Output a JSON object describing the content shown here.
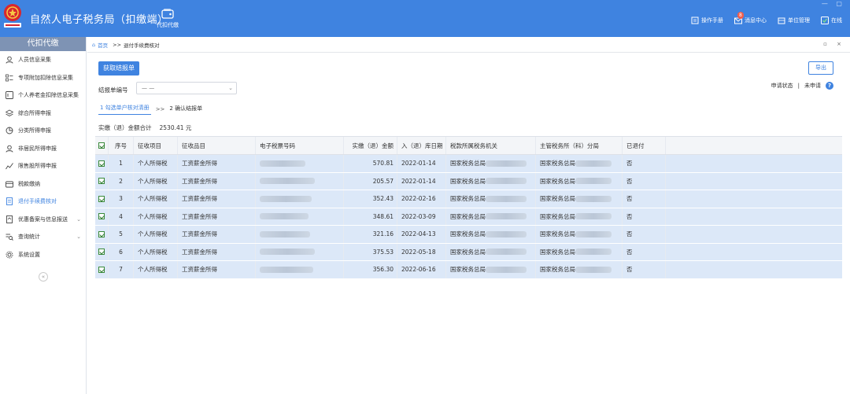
{
  "app": {
    "title": "自然人电子税务局（扣缴端）",
    "nav_label": "代扣代缴",
    "window_controls": "— ▢"
  },
  "top_actions": [
    {
      "label": "操作手册",
      "icon": "book-icon"
    },
    {
      "label": "消息中心",
      "icon": "mail-icon",
      "badge": "8"
    },
    {
      "label": "单位管理",
      "icon": "building-icon"
    },
    {
      "label": "在线",
      "icon": "online-check-icon"
    }
  ],
  "sidebar": {
    "header": "代扣代缴",
    "items": [
      {
        "label": "人员信息采集",
        "icon": "person-icon"
      },
      {
        "label": "专项附加扣除信息采集",
        "icon": "list-icon"
      },
      {
        "label": "个人养老金扣除信息采集",
        "icon": "card-icon"
      },
      {
        "label": "综合所得申报",
        "icon": "layers-icon"
      },
      {
        "label": "分类所得申报",
        "icon": "pie-icon"
      },
      {
        "label": "非居民所得申报",
        "icon": "user-globe-icon"
      },
      {
        "label": "限售股所得申报",
        "icon": "chart-icon"
      },
      {
        "label": "税款缴纳",
        "icon": "wallet-icon"
      },
      {
        "label": "退付手续费核对",
        "icon": "doc-icon",
        "active": true
      },
      {
        "label": "优惠备案与信息报送",
        "icon": "file-up-icon",
        "chevron": "⌄"
      },
      {
        "label": "查询统计",
        "icon": "search-list-icon",
        "chevron": "⌄"
      },
      {
        "label": "系统设置",
        "icon": "gear-icon"
      }
    ],
    "collapse": "«"
  },
  "breadcrumb": {
    "home": "首页",
    "sep": ">>",
    "current": "退付手续费核对",
    "controls": "▫ ×"
  },
  "toolbar": {
    "fetch_label": "获取结报单",
    "export_label": "导出",
    "status_label": "申请状态",
    "status_divider": "|",
    "status_value": "未申请",
    "help": "?"
  },
  "form": {
    "label": "结报单编号",
    "select_value": "— —",
    "caret": "⌄"
  },
  "steps": {
    "step1": "1 勾选单户核对清册",
    "sep": ">>",
    "step2": "2 确认结报单"
  },
  "total": {
    "label": "实缴（退）金额合计",
    "value": "2530.41 元"
  },
  "table": {
    "headers": [
      "序号",
      "征收项目",
      "征收品目",
      "电子税票号码",
      "实缴（退）金额",
      "入（退）库日期",
      "税款所属税务机关",
      "主管税务所（科）分局",
      "已退付"
    ],
    "rows": [
      {
        "no": "1",
        "item": "个人所得税",
        "category": "工资薪金所得",
        "amount": "570.81",
        "date": "2022-01-14",
        "org": "国家税务总局",
        "tax": "国家税务总局",
        "returned": "否"
      },
      {
        "no": "2",
        "item": "个人所得税",
        "category": "工资薪金所得",
        "amount": "205.57",
        "date": "2022-01-14",
        "org": "国家税务总局",
        "tax": "国家税务总局",
        "returned": "否"
      },
      {
        "no": "3",
        "item": "个人所得税",
        "category": "工资薪金所得",
        "amount": "352.43",
        "date": "2022-02-16",
        "org": "国家税务总局",
        "tax": "国家税务总局",
        "returned": "否"
      },
      {
        "no": "4",
        "item": "个人所得税",
        "category": "工资薪金所得",
        "amount": "348.61",
        "date": "2022-03-09",
        "org": "国家税务总局",
        "tax": "国家税务总局",
        "returned": "否"
      },
      {
        "no": "5",
        "item": "个人所得税",
        "category": "工资薪金所得",
        "amount": "321.16",
        "date": "2022-04-13",
        "org": "国家税务总局",
        "tax": "国家税务总局",
        "returned": "否"
      },
      {
        "no": "6",
        "item": "个人所得税",
        "category": "工资薪金所得",
        "amount": "375.53",
        "date": "2022-05-18",
        "org": "国家税务总局",
        "tax": "国家税务总局",
        "returned": "否"
      },
      {
        "no": "7",
        "item": "个人所得税",
        "category": "工资薪金所得",
        "amount": "356.30",
        "date": "2022-06-16",
        "org": "国家税务总局",
        "tax": "国家税务总局",
        "returned": "否"
      }
    ]
  },
  "colors": {
    "brand": "#3f83e0",
    "row_selected": "#dce8f8",
    "sidebar_header": "#7e93b4"
  }
}
